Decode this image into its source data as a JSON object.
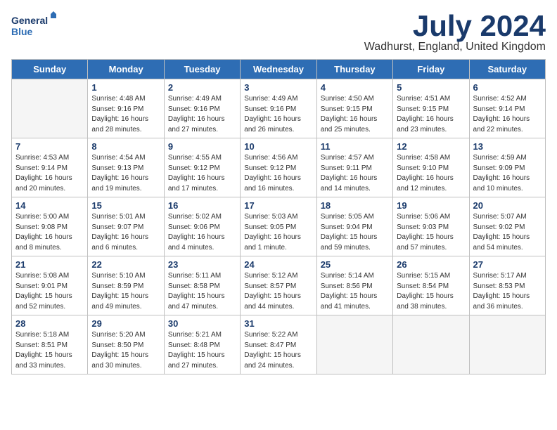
{
  "header": {
    "logo_line1": "General",
    "logo_line2": "Blue",
    "month_year": "July 2024",
    "location": "Wadhurst, England, United Kingdom"
  },
  "weekdays": [
    "Sunday",
    "Monday",
    "Tuesday",
    "Wednesday",
    "Thursday",
    "Friday",
    "Saturday"
  ],
  "weeks": [
    [
      {
        "day": "",
        "info": ""
      },
      {
        "day": "1",
        "info": "Sunrise: 4:48 AM\nSunset: 9:16 PM\nDaylight: 16 hours\nand 28 minutes."
      },
      {
        "day": "2",
        "info": "Sunrise: 4:49 AM\nSunset: 9:16 PM\nDaylight: 16 hours\nand 27 minutes."
      },
      {
        "day": "3",
        "info": "Sunrise: 4:49 AM\nSunset: 9:16 PM\nDaylight: 16 hours\nand 26 minutes."
      },
      {
        "day": "4",
        "info": "Sunrise: 4:50 AM\nSunset: 9:15 PM\nDaylight: 16 hours\nand 25 minutes."
      },
      {
        "day": "5",
        "info": "Sunrise: 4:51 AM\nSunset: 9:15 PM\nDaylight: 16 hours\nand 23 minutes."
      },
      {
        "day": "6",
        "info": "Sunrise: 4:52 AM\nSunset: 9:14 PM\nDaylight: 16 hours\nand 22 minutes."
      }
    ],
    [
      {
        "day": "7",
        "info": "Sunrise: 4:53 AM\nSunset: 9:14 PM\nDaylight: 16 hours\nand 20 minutes."
      },
      {
        "day": "8",
        "info": "Sunrise: 4:54 AM\nSunset: 9:13 PM\nDaylight: 16 hours\nand 19 minutes."
      },
      {
        "day": "9",
        "info": "Sunrise: 4:55 AM\nSunset: 9:12 PM\nDaylight: 16 hours\nand 17 minutes."
      },
      {
        "day": "10",
        "info": "Sunrise: 4:56 AM\nSunset: 9:12 PM\nDaylight: 16 hours\nand 16 minutes."
      },
      {
        "day": "11",
        "info": "Sunrise: 4:57 AM\nSunset: 9:11 PM\nDaylight: 16 hours\nand 14 minutes."
      },
      {
        "day": "12",
        "info": "Sunrise: 4:58 AM\nSunset: 9:10 PM\nDaylight: 16 hours\nand 12 minutes."
      },
      {
        "day": "13",
        "info": "Sunrise: 4:59 AM\nSunset: 9:09 PM\nDaylight: 16 hours\nand 10 minutes."
      }
    ],
    [
      {
        "day": "14",
        "info": "Sunrise: 5:00 AM\nSunset: 9:08 PM\nDaylight: 16 hours\nand 8 minutes."
      },
      {
        "day": "15",
        "info": "Sunrise: 5:01 AM\nSunset: 9:07 PM\nDaylight: 16 hours\nand 6 minutes."
      },
      {
        "day": "16",
        "info": "Sunrise: 5:02 AM\nSunset: 9:06 PM\nDaylight: 16 hours\nand 4 minutes."
      },
      {
        "day": "17",
        "info": "Sunrise: 5:03 AM\nSunset: 9:05 PM\nDaylight: 16 hours\nand 1 minute."
      },
      {
        "day": "18",
        "info": "Sunrise: 5:05 AM\nSunset: 9:04 PM\nDaylight: 15 hours\nand 59 minutes."
      },
      {
        "day": "19",
        "info": "Sunrise: 5:06 AM\nSunset: 9:03 PM\nDaylight: 15 hours\nand 57 minutes."
      },
      {
        "day": "20",
        "info": "Sunrise: 5:07 AM\nSunset: 9:02 PM\nDaylight: 15 hours\nand 54 minutes."
      }
    ],
    [
      {
        "day": "21",
        "info": "Sunrise: 5:08 AM\nSunset: 9:01 PM\nDaylight: 15 hours\nand 52 minutes."
      },
      {
        "day": "22",
        "info": "Sunrise: 5:10 AM\nSunset: 8:59 PM\nDaylight: 15 hours\nand 49 minutes."
      },
      {
        "day": "23",
        "info": "Sunrise: 5:11 AM\nSunset: 8:58 PM\nDaylight: 15 hours\nand 47 minutes."
      },
      {
        "day": "24",
        "info": "Sunrise: 5:12 AM\nSunset: 8:57 PM\nDaylight: 15 hours\nand 44 minutes."
      },
      {
        "day": "25",
        "info": "Sunrise: 5:14 AM\nSunset: 8:56 PM\nDaylight: 15 hours\nand 41 minutes."
      },
      {
        "day": "26",
        "info": "Sunrise: 5:15 AM\nSunset: 8:54 PM\nDaylight: 15 hours\nand 38 minutes."
      },
      {
        "day": "27",
        "info": "Sunrise: 5:17 AM\nSunset: 8:53 PM\nDaylight: 15 hours\nand 36 minutes."
      }
    ],
    [
      {
        "day": "28",
        "info": "Sunrise: 5:18 AM\nSunset: 8:51 PM\nDaylight: 15 hours\nand 33 minutes."
      },
      {
        "day": "29",
        "info": "Sunrise: 5:20 AM\nSunset: 8:50 PM\nDaylight: 15 hours\nand 30 minutes."
      },
      {
        "day": "30",
        "info": "Sunrise: 5:21 AM\nSunset: 8:48 PM\nDaylight: 15 hours\nand 27 minutes."
      },
      {
        "day": "31",
        "info": "Sunrise: 5:22 AM\nSunset: 8:47 PM\nDaylight: 15 hours\nand 24 minutes."
      },
      {
        "day": "",
        "info": ""
      },
      {
        "day": "",
        "info": ""
      },
      {
        "day": "",
        "info": ""
      }
    ]
  ]
}
